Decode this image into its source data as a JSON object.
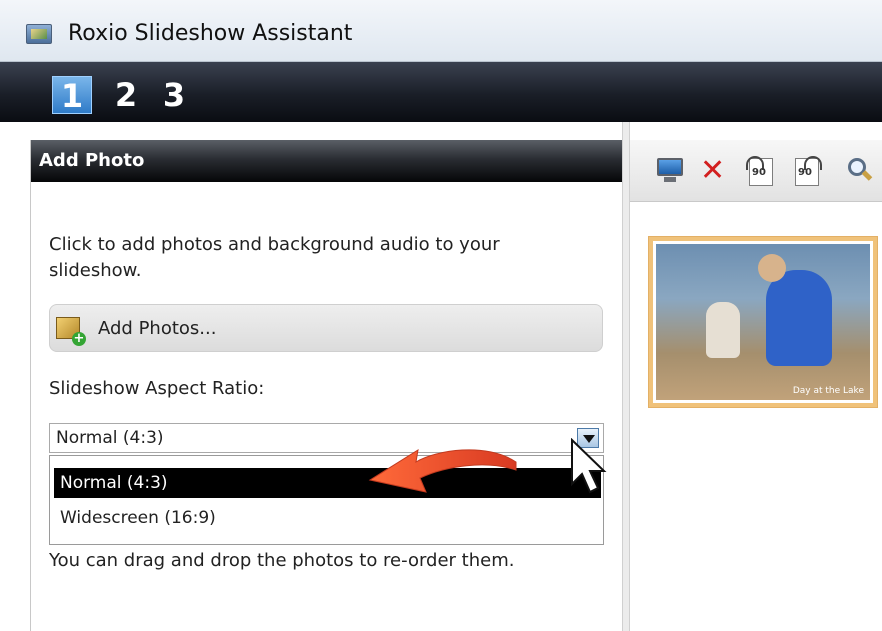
{
  "window": {
    "title": "Roxio Slideshow Assistant"
  },
  "steps": [
    "1",
    "2",
    "3"
  ],
  "active_step": "1",
  "left_panel": {
    "header": "Add Photo",
    "intro": "Click to add photos and background audio to your slideshow.",
    "add_photos_label": "Add Photos...",
    "aspect_ratio_label": "Slideshow Aspect Ratio:",
    "aspect_ratio_value": "Normal (4:3)",
    "aspect_ratio_options": [
      "Normal (4:3)",
      "Widescreen (16:9)"
    ],
    "hint": "You can drag and drop the photos to re-order them."
  },
  "toolbar": {
    "icons": [
      "monitor-icon",
      "delete-icon",
      "rotate-left-icon",
      "rotate-right-icon",
      "zoom-icon"
    ],
    "rotate_left_label": "90",
    "rotate_right_label": "90"
  },
  "photo": {
    "caption": "Day at the Lake"
  },
  "colors": {
    "accent": "#2f7bc8",
    "selected_option_bg": "#000000",
    "arrow": "#e24a2b",
    "photo_frame": "#f0c27a"
  }
}
